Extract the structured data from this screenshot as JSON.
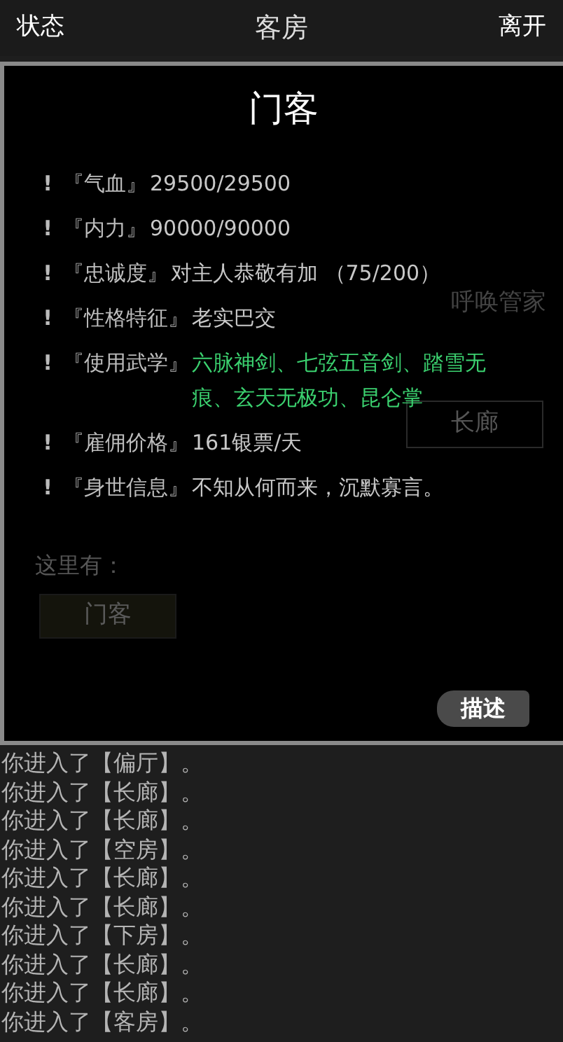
{
  "header": {
    "left_button": "状态",
    "title": "客房",
    "right_button": "离开"
  },
  "room": {
    "action": "呼唤管家",
    "exits": [
      {
        "label": "长廊"
      }
    ],
    "here_label": "这里有：",
    "npcs": [
      {
        "label": "门客"
      }
    ]
  },
  "dialog": {
    "title": "门客",
    "fields": [
      {
        "marker": "!",
        "label": "『气血』",
        "value": "29500/29500",
        "kind": "plain"
      },
      {
        "marker": "!",
        "label": "『内力』",
        "value": "90000/90000",
        "kind": "plain"
      },
      {
        "marker": "!",
        "label": "『忠诚度』",
        "value": "对主人恭敬有加 （75/200）",
        "kind": "plain"
      },
      {
        "marker": "!",
        "label": "『性格特征』",
        "value": "老实巴交",
        "kind": "plain"
      },
      {
        "marker": "!",
        "label": "『使用武学』",
        "value": "六脉神剑、七弦五音剑、踏雪无痕、玄天无极功、昆仑掌",
        "kind": "skill"
      },
      {
        "marker": "!",
        "label": "『雇佣价格』",
        "value": "161银票/天",
        "kind": "plain"
      },
      {
        "marker": "!",
        "label": "『身世信息』",
        "value": "不知从何而来，沉默寡言。",
        "kind": "plain"
      }
    ],
    "describe_button": "描述"
  },
  "log": [
    "你进入了【偏厅】。",
    "你进入了【长廊】。",
    "你进入了【长廊】。",
    "你进入了【空房】。",
    "你进入了【长廊】。",
    "你进入了【长廊】。",
    "你进入了【下房】。",
    "你进入了【长廊】。",
    "你进入了【长廊】。",
    "你进入了【客房】。"
  ]
}
